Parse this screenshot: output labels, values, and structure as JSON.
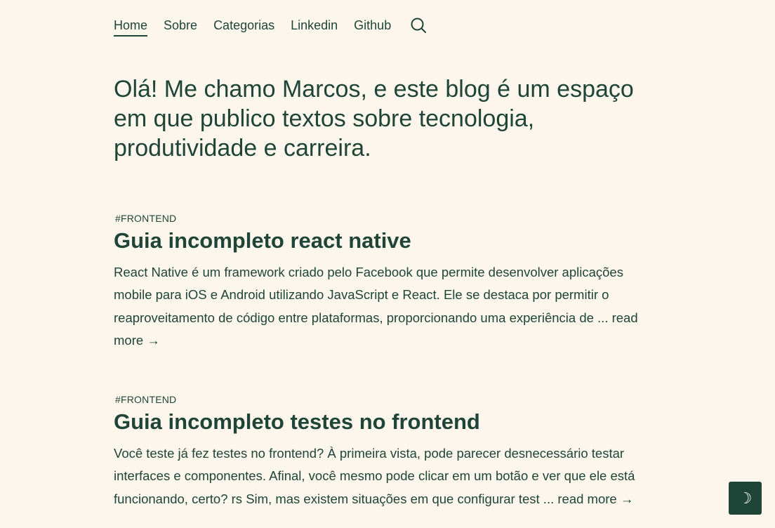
{
  "nav": {
    "items": [
      {
        "label": "Home",
        "active": true
      },
      {
        "label": "Sobre"
      },
      {
        "label": "Categorias"
      },
      {
        "label": "Linkedin"
      },
      {
        "label": "Github"
      }
    ],
    "search_icon": "search-icon"
  },
  "intro": {
    "text": "Olá! Me chamo Marcos, e este blog é um espaço em que publico textos sobre tecnologia, produtividade e carreira."
  },
  "posts": [
    {
      "tag": "#FRONTEND",
      "title": "Guia incompleto react native",
      "excerpt": "React Native é um framework criado pelo Facebook que permite desenvolver aplicações mobile para iOS e Android utilizando JavaScript e React. Ele se destaca por permitir o reaproveitamento de código entre plataformas, proporcionando uma experiência de ...",
      "read_more": "read more →"
    },
    {
      "tag": "#FRONTEND",
      "title": "Guia incompleto testes no frontend",
      "excerpt": "Você teste já fez testes no frontend? À primeira vista, pode parecer desnecessário testar interfaces e componentes. Afinal, você mesmo pode clicar em um botão e ver que ele está funcionando, certo? rs Sim, mas existem situações em que configurar test ...",
      "read_more": "read more →"
    }
  ],
  "theme_toggle": {
    "glyph": "☽",
    "icon": "moon-icon"
  },
  "colors": {
    "background": "#fdf6ec",
    "text": "#1f4438",
    "toggle_bg": "#1f4438"
  }
}
